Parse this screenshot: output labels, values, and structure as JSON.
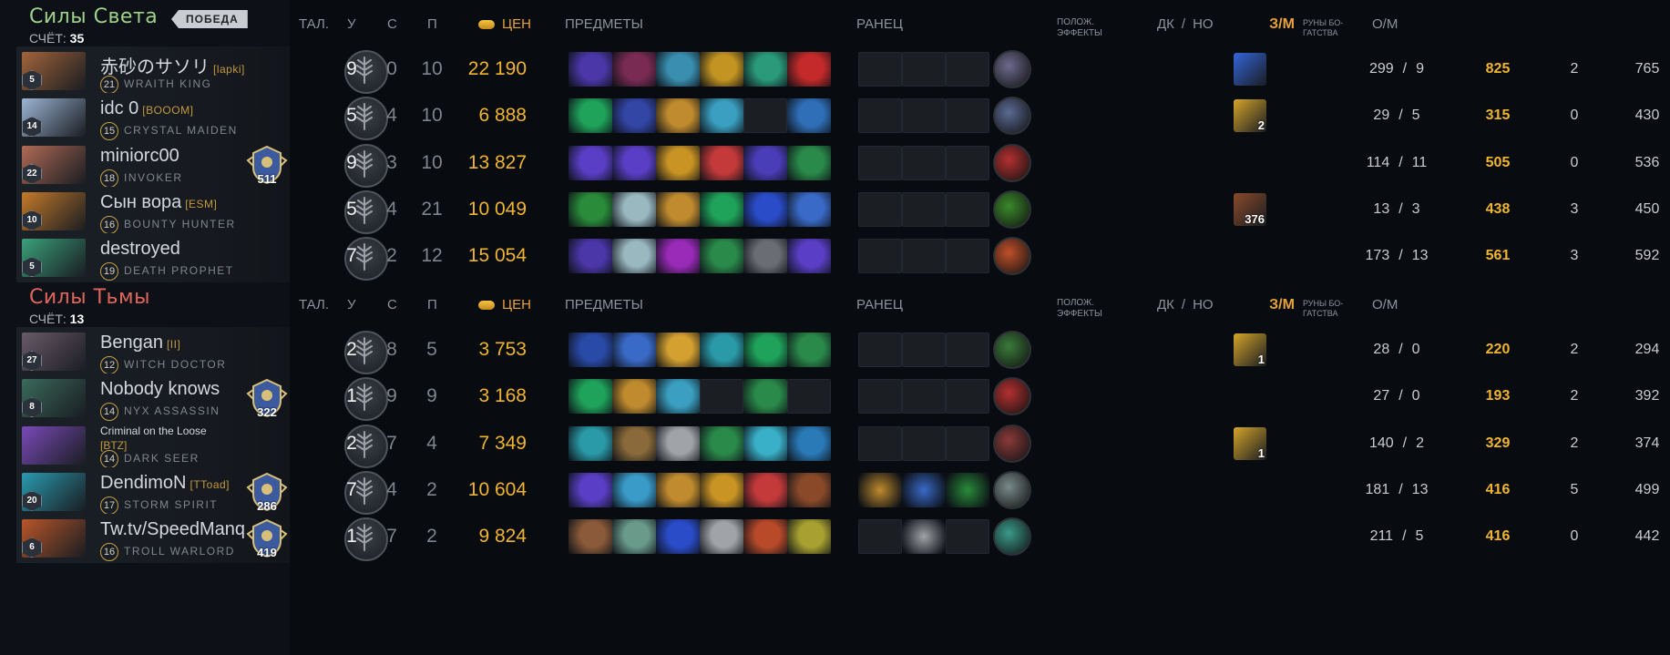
{
  "headers": {
    "talents": "ТАЛ.",
    "level": "У",
    "deaths": "С",
    "assists": "П",
    "networth": "ЦЕН",
    "items": "ПРЕДМЕТЫ",
    "backpack": "РАНЕЦ",
    "buffs_line1": "ПОЛОЖ.",
    "buffs_line2": "ЭФФЕКТЫ",
    "lh": "ДК",
    "slash": "/",
    "dn": "НО",
    "gpm": "З/М",
    "bounty_line1": "РУНЫ БО-",
    "bounty_line2": "ГАТСТВА",
    "xpm": "О/М"
  },
  "colors": {
    "radiant": "#9fd28a",
    "dire": "#e0665a",
    "gold": "#f0b530"
  },
  "teams": [
    {
      "name": "Силы Света",
      "score_label": "СЧЁТ:",
      "score": "35",
      "badge": "ПОБЕДА",
      "players": [
        {
          "name": "赤砂のサソリ",
          "tag": "[lapki]",
          "hero": "WRAITH KING",
          "hero_level": "21",
          "portrait_level": "5",
          "rank": "",
          "portrait_color": "#a3643a",
          "k": "9",
          "d": "0",
          "a": "10",
          "networth": "22 190",
          "items": [
            "#4b37a8",
            "#7a2b54",
            "#3a8fb0",
            "#c39421",
            "#2a9a7a",
            "#c42a2a"
          ],
          "backpack": [
            "",
            "",
            ""
          ],
          "neutral": "#6e6a8e",
          "buff": "#3465d9",
          "buff_count": "",
          "lh": "299",
          "dn": "9",
          "gpm": "825",
          "bounty": "2",
          "xpm": "765"
        },
        {
          "name": "idc 0",
          "tag": "[BOOOM]",
          "hero": "CRYSTAL MAIDEN",
          "hero_level": "15",
          "portrait_level": "14",
          "rank": "",
          "portrait_color": "#9cb5d4",
          "k": "5",
          "d": "4",
          "a": "10",
          "networth": "6 888",
          "items": [
            "#1fa25a",
            "#3345a5",
            "#c08b2e",
            "#3a9fc0",
            "",
            "#2f6fb8"
          ],
          "backpack": [
            "",
            "",
            ""
          ],
          "neutral": "#5b6a94",
          "buff": "#d6a52a",
          "buff_count": "2",
          "lh": "29",
          "dn": "5",
          "gpm": "315",
          "bounty": "0",
          "xpm": "430"
        },
        {
          "name": "miniorc00",
          "tag": "",
          "hero": "INVOKER",
          "hero_level": "18",
          "portrait_level": "22",
          "rank": "511",
          "portrait_color": "#b06a55",
          "k": "9",
          "d": "3",
          "a": "10",
          "networth": "13 827",
          "items": [
            "#5a3fc6",
            "#5a3fc6",
            "#c99424",
            "#c43a3a",
            "#4a3db8",
            "#2a8a4a"
          ],
          "backpack": [
            "",
            "",
            ""
          ],
          "neutral": "#b43030",
          "buff": "",
          "buff_count": "",
          "lh": "114",
          "dn": "11",
          "gpm": "505",
          "bounty": "0",
          "xpm": "536"
        },
        {
          "name": "Сын вора",
          "tag": "[ESM]",
          "hero": "BOUNTY HUNTER",
          "hero_level": "16",
          "portrait_level": "10",
          "rank": "",
          "portrait_color": "#c47a2a",
          "k": "5",
          "d": "4",
          "a": "21",
          "networth": "10 049",
          "items": [
            "#2a8c3a",
            "#9ab8c0",
            "#c08b2e",
            "#1fa25a",
            "#2a4cc8",
            "#3a6ac8"
          ],
          "backpack": [
            "",
            "",
            ""
          ],
          "neutral": "#3a8a2a",
          "buff": "#8a4a2a",
          "buff_count": "376",
          "lh": "13",
          "dn": "3",
          "gpm": "438",
          "bounty": "3",
          "xpm": "450"
        },
        {
          "name": "destroyed",
          "tag": "",
          "hero": "DEATH PROPHET",
          "hero_level": "19",
          "portrait_level": "5",
          "rank": "",
          "portrait_color": "#3aa07a",
          "k": "7",
          "d": "2",
          "a": "12",
          "networth": "15 054",
          "items": [
            "#4b37a8",
            "#9ab8c0",
            "#9a2ab8",
            "#2a8a4a",
            "#6a6e74",
            "#5a3fc6"
          ],
          "backpack": [
            "",
            "",
            ""
          ],
          "neutral": "#c0502a",
          "buff": "",
          "buff_count": "",
          "lh": "173",
          "dn": "13",
          "gpm": "561",
          "bounty": "3",
          "xpm": "592"
        }
      ]
    },
    {
      "name": "Силы Тьмы",
      "score_label": "СЧЁТ:",
      "score": "13",
      "badge": "",
      "players": [
        {
          "name": "Bengan",
          "tag": "[II]",
          "hero": "WITCH DOCTOR",
          "hero_level": "12",
          "portrait_level": "27",
          "rank": "",
          "portrait_color": "#6a5a6a",
          "k": "2",
          "d": "8",
          "a": "5",
          "networth": "3 753",
          "items": [
            "#2a4aa8",
            "#3a6ac8",
            "#d4a030",
            "#2a9aa8",
            "#1fa25a",
            "#2a8a4a"
          ],
          "backpack": [
            "",
            "",
            ""
          ],
          "neutral": "#3a7a3a",
          "buff": "#d6a52a",
          "buff_count": "1",
          "lh": "28",
          "dn": "0",
          "gpm": "220",
          "bounty": "2",
          "xpm": "294"
        },
        {
          "name": "Nobody knows",
          "tag": "",
          "hero": "NYX ASSASSIN",
          "hero_level": "14",
          "portrait_level": "8",
          "rank": "322",
          "portrait_color": "#3a6a5a",
          "k": "1",
          "d": "9",
          "a": "9",
          "networth": "3 168",
          "items": [
            "#1fa25a",
            "#c08b2e",
            "#3a9fc0",
            "",
            "#2a8a4a",
            ""
          ],
          "backpack": [
            "",
            "",
            ""
          ],
          "neutral": "#b43030",
          "buff": "",
          "buff_count": "",
          "lh": "27",
          "dn": "0",
          "gpm": "193",
          "bounty": "2",
          "xpm": "392"
        },
        {
          "name": "Criminal on the Loose",
          "tag": "[BTZ]",
          "hero": "DARK SEER",
          "hero_level": "14",
          "portrait_level": "",
          "rank": "",
          "portrait_color": "#7a4ab8",
          "k": "2",
          "d": "7",
          "a": "4",
          "networth": "7 349",
          "items": [
            "#2a9aa8",
            "#8a6a3a",
            "#a0a4a8",
            "#2a8a4a",
            "#3ab0c8",
            "#2a7ab8"
          ],
          "backpack": [
            "",
            "",
            ""
          ],
          "neutral": "#8a3a3a",
          "buff": "#d6a52a",
          "buff_count": "1",
          "lh": "140",
          "dn": "2",
          "gpm": "329",
          "bounty": "2",
          "xpm": "374"
        },
        {
          "name": "DendimoN",
          "tag": "[TToad]",
          "hero": "STORM SPIRIT",
          "hero_level": "17",
          "portrait_level": "20",
          "rank": "286",
          "portrait_color": "#2a9ab0",
          "k": "7",
          "d": "4",
          "a": "2",
          "networth": "10 604",
          "items": [
            "#5a3fc6",
            "#3a9ac8",
            "#c08b2e",
            "#c99424",
            "#c43a3a",
            "#8a4a2a"
          ],
          "backpack": [
            "#c08b2e",
            "#3a6ac8",
            "#2a8c3a"
          ],
          "neutral": "#7a8a8a",
          "buff": "",
          "buff_count": "",
          "lh": "181",
          "dn": "13",
          "gpm": "416",
          "bounty": "5",
          "xpm": "499"
        },
        {
          "name": "Tw.tv/SpeedManq",
          "tag": "",
          "hero": "TROLL WARLORD",
          "hero_level": "16",
          "portrait_level": "6",
          "rank": "419",
          "portrait_color": "#b8562a",
          "k": "1",
          "d": "7",
          "a": "2",
          "networth": "9 824",
          "items": [
            "#8a5a3a",
            "#6a9a8a",
            "#2a4cc8",
            "#a0a4a8",
            "#b84a2a",
            "#a8a030"
          ],
          "backpack": [
            "",
            "#a0a4a8",
            ""
          ],
          "neutral": "#3a9a8a",
          "buff": "",
          "buff_count": "",
          "lh": "211",
          "dn": "5",
          "gpm": "416",
          "bounty": "0",
          "xpm": "442"
        }
      ]
    }
  ]
}
